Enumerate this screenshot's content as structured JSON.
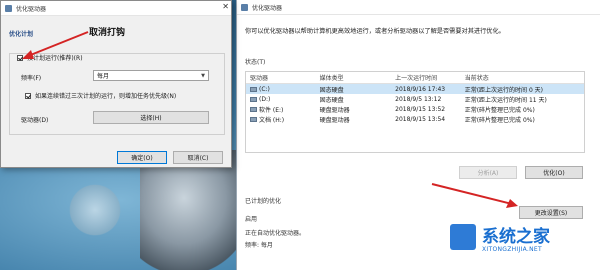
{
  "main": {
    "title": "优化驱动器",
    "intro": "你可以优化驱动器以帮助计算机更高效地运行，或者分析驱动器以了解是否需要对其进行优化。",
    "status_label": "状态(T)",
    "columns": [
      "驱动器",
      "媒体类型",
      "上一次运行时间",
      "当前状态"
    ],
    "drives": [
      {
        "name": "(C:)",
        "media": "固态硬盘",
        "last_run": "2018/9/16 17:43",
        "status": "正常(距上次运行的时间 0 天)"
      },
      {
        "name": "(D:)",
        "media": "固态硬盘",
        "last_run": "2018/9/5 13:12",
        "status": "正常(距上次运行的时间 11 天)"
      },
      {
        "name": "软件 (E:)",
        "media": "硬盘驱动器",
        "last_run": "2018/9/15 13:52",
        "status": "正常(碎片整理已完成 0%)"
      },
      {
        "name": "文档 (H:)",
        "media": "硬盘驱动器",
        "last_run": "2018/9/15 13:54",
        "status": "正常(碎片整理已完成 0%)"
      }
    ],
    "analyze_label": "分析(A)",
    "optimize_label": "优化(O)",
    "scheduled_label": "已计划的优化",
    "enabled_label": "启用",
    "auto_text": "正在自动优化驱动器。",
    "freq_text": "频率: 每月",
    "change_settings_label": "更改设置(S)"
  },
  "dialog": {
    "title": "优化驱动器",
    "section": "优化计划",
    "annotation": "取消打钩",
    "run_schedule_label": "按计划运行(推荐)(R)",
    "frequency_label": "频率(F)",
    "frequency_value": "每月",
    "increase_priority_label": "如果连续错过三次计划的运行，则增加任务优先级(N)",
    "drives_label": "驱动器(D)",
    "choose_label": "选择(H)",
    "ok_label": "确定(O)",
    "cancel_label": "取消(C)"
  },
  "watermark": {
    "name": "系统之家",
    "url": "XITONGZHIJIA.NET"
  }
}
